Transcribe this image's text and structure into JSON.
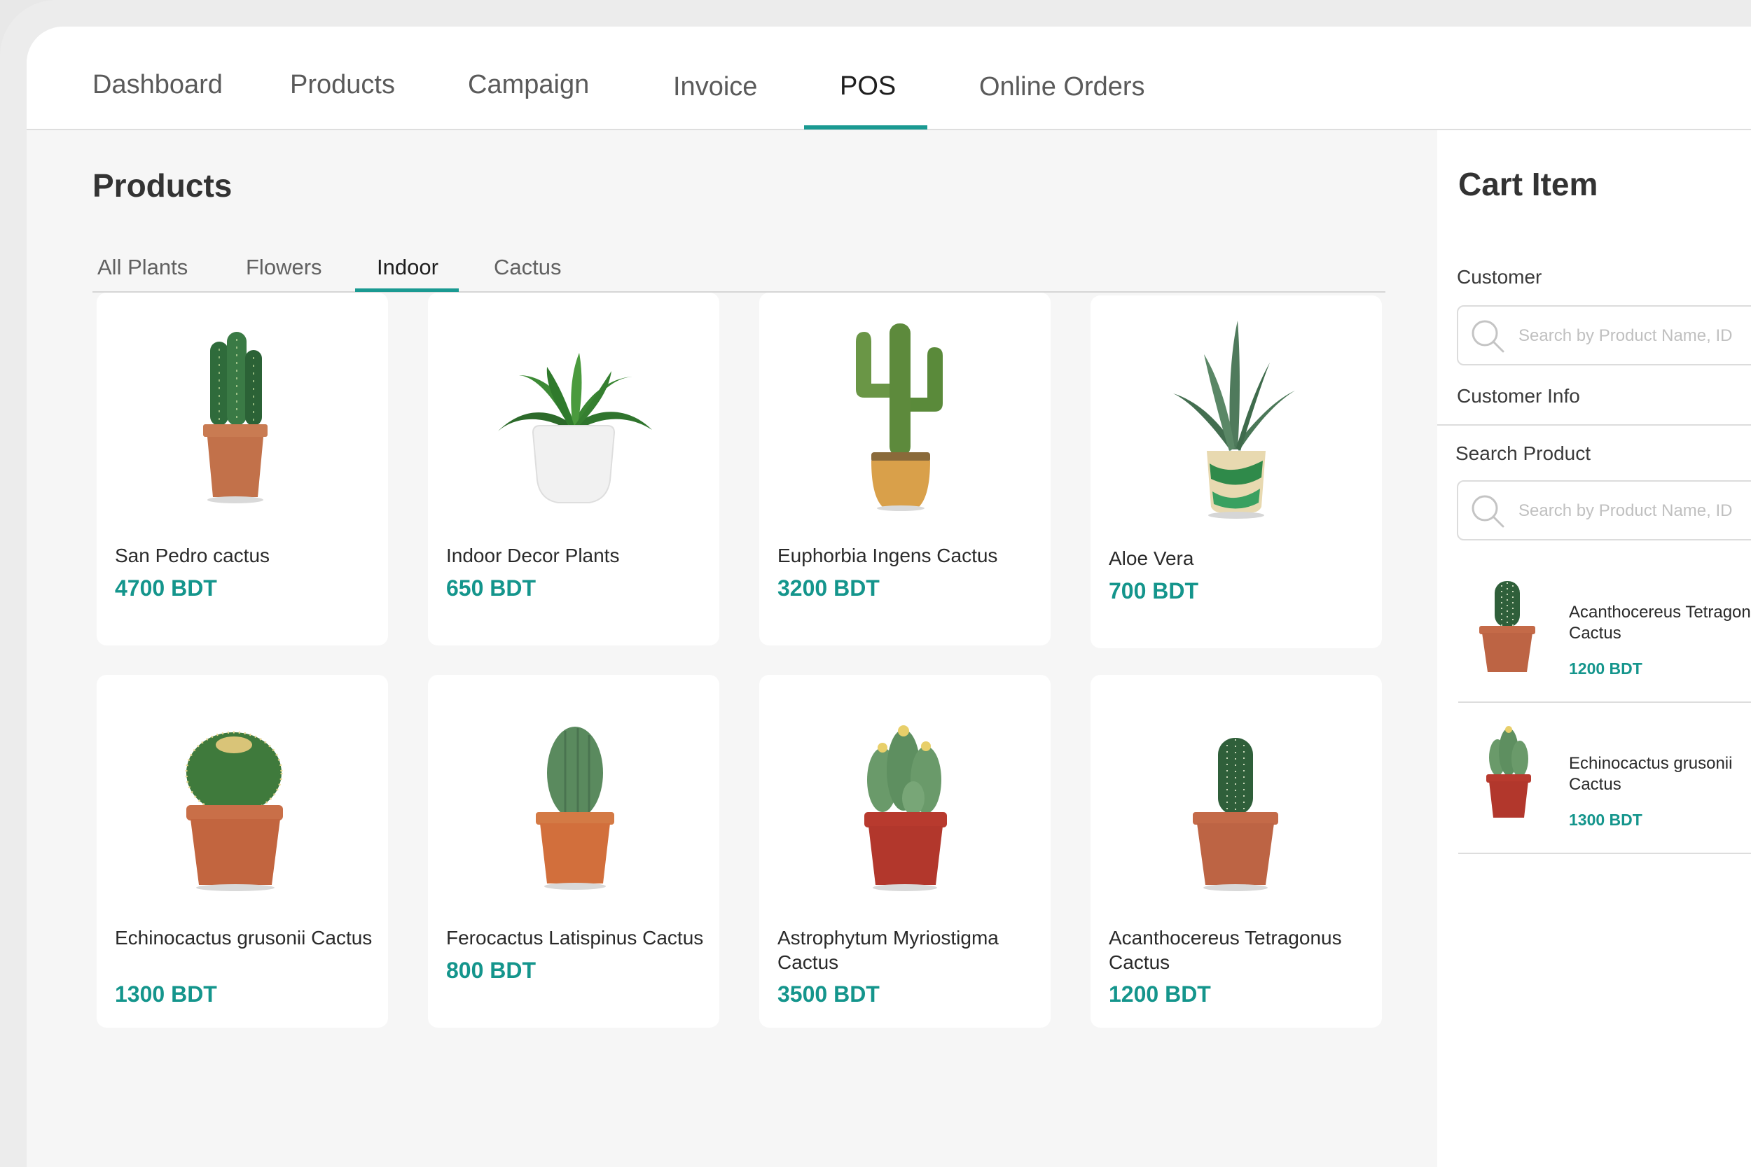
{
  "nav": {
    "tabs": [
      "Dashboard",
      "Products",
      "Campaign",
      "Invoice",
      "POS",
      "Online Orders"
    ],
    "active": "POS"
  },
  "products": {
    "title": "Products",
    "categories": [
      "All Plants",
      "Flowers",
      "Indoor",
      "Cactus"
    ],
    "active_category": "Indoor",
    "items": [
      {
        "name": "San Pedro cactus",
        "price": "4700 BDT",
        "icon": "columnar-cactus-terracotta-pot"
      },
      {
        "name": "Indoor Decor Plants",
        "price": "650 BDT",
        "icon": "leafy-plant-white-pot"
      },
      {
        "name": "Euphorbia Ingens Cactus",
        "price": "3200 BDT",
        "icon": "branching-cactus-yellow-pot"
      },
      {
        "name": "Aloe Vera",
        "price": "700 BDT",
        "icon": "aloe-patterned-pot"
      },
      {
        "name": "Echinocactus grusonii Cactus",
        "price": "1300 BDT",
        "icon": "barrel-cactus-terracotta-pot"
      },
      {
        "name": "Ferocactus Latispinus Cactus",
        "price": "800 BDT",
        "icon": "oval-cactus-orange-pot"
      },
      {
        "name": "Astrophytum Myriostigma Cactus",
        "price": "3500 BDT",
        "icon": "cluster-cactus-red-pot"
      },
      {
        "name": "Acanthocereus Tetragonus Cactus",
        "price": "1200 BDT",
        "icon": "spiny-cactus-terracotta-pot"
      }
    ]
  },
  "cart": {
    "title": "Cart Item",
    "customer_label": "Customer",
    "customer_search_placeholder": "Search by Product Name, ID",
    "customer_info_label": "Customer Info",
    "search_product_label": "Search Product",
    "product_search_placeholder": "Search by Product Name, ID",
    "items": [
      {
        "name_line1": "Acanthocereus Tetragonus",
        "name_line2": "Cactus",
        "price": "1200 BDT"
      },
      {
        "name_line1": "Echinocactus grusonii",
        "name_line2": "Cactus",
        "price": "1300 BDT"
      }
    ]
  },
  "colors": {
    "accent": "#1a9a92",
    "price": "#14958c"
  }
}
